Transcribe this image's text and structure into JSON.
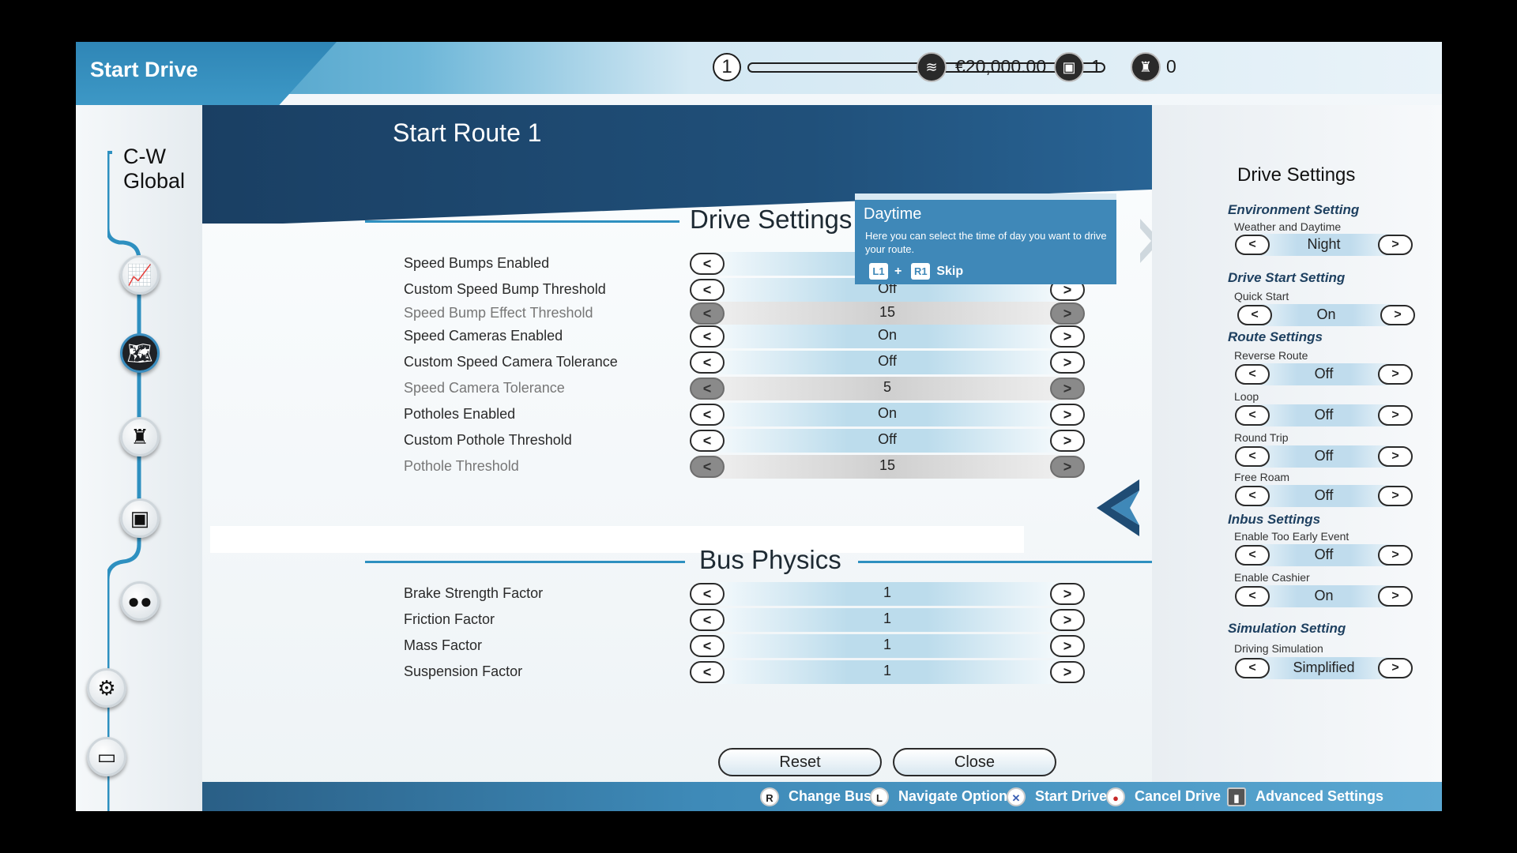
{
  "app": {
    "title": "Start Drive"
  },
  "topbar": {
    "level": "1",
    "level_progress": 0.0,
    "money": "€20,000.00",
    "buses": "1",
    "drivers": "0"
  },
  "sidebar": {
    "company": "C-W Global",
    "buttons": [
      "stats",
      "map",
      "driver",
      "bus",
      "people",
      "settings",
      "monitor"
    ]
  },
  "route": {
    "title": "Start Route 1"
  },
  "drive_settings": {
    "heading": "Drive Settings",
    "rows": [
      {
        "label": "Speed Bumps Enabled",
        "value": "",
        "dim": false
      },
      {
        "label": "Custom Speed Bump Threshold",
        "value": "Off",
        "dim": false
      },
      {
        "label": "Speed Bump Effect Threshold",
        "value": "15",
        "dim": true
      },
      {
        "label": "Speed Cameras Enabled",
        "value": "On",
        "dim": false
      },
      {
        "label": "Custom Speed Camera Tolerance",
        "value": "Off",
        "dim": false
      },
      {
        "label": "Speed Camera Tolerance",
        "value": "5",
        "dim": true
      },
      {
        "label": "Potholes Enabled",
        "value": "On",
        "dim": false
      },
      {
        "label": "Custom Pothole Threshold",
        "value": "Off",
        "dim": false
      },
      {
        "label": "Pothole Threshold",
        "value": "15",
        "dim": true
      }
    ]
  },
  "bus_physics": {
    "heading": "Bus Physics",
    "rows": [
      {
        "label": "Brake Strength Factor",
        "value": "1"
      },
      {
        "label": "Friction Factor",
        "value": "1"
      },
      {
        "label": "Mass Factor",
        "value": "1"
      },
      {
        "label": "Suspension Factor",
        "value": "1"
      }
    ]
  },
  "arrows": {
    "left": "<",
    "right": ">"
  },
  "buttons": {
    "reset": "Reset",
    "close": "Close"
  },
  "tooltip": {
    "title": "Daytime",
    "text": "Here you can select the time of day you want to drive your route.",
    "key1": "L1",
    "plus": "+",
    "key2": "R1",
    "skip": "Skip"
  },
  "right_panel": {
    "heading": "Drive Settings",
    "env_cat": "Environment Setting",
    "env_sub": "Weather and Daytime",
    "env_val": "Night",
    "start_cat": "Drive Start Setting",
    "start_sub": "Quick Start",
    "start_val": "On",
    "route_cat": "Route Settings",
    "reverse_sub": "Reverse Route",
    "reverse_val": "Off",
    "loop_sub": "Loop",
    "loop_val": "Off",
    "round_sub": "Round Trip",
    "round_val": "Off",
    "roam_sub": "Free Roam",
    "roam_val": "Off",
    "inbus_cat": "Inbus Settings",
    "early_sub": "Enable Too Early Event",
    "early_val": "Off",
    "cashier_sub": "Enable Cashier",
    "cashier_val": "On",
    "sim_cat": "Simulation Setting",
    "sim_sub": "Driving Simulation",
    "sim_val": "Simplified"
  },
  "bottom_hints": {
    "change_bus_key": "R",
    "change_bus": "Change Bus",
    "navigate_key": "L",
    "navigate": "Navigate Options",
    "start_key": "✕",
    "start": "Start Drive",
    "cancel_key": "●",
    "cancel": "Cancel Drive",
    "advanced": "Advanced Settings"
  },
  "colors": {
    "accent": "#2e90c0",
    "title_band": "#1f4c74",
    "tooltip": "#3f88b8"
  }
}
